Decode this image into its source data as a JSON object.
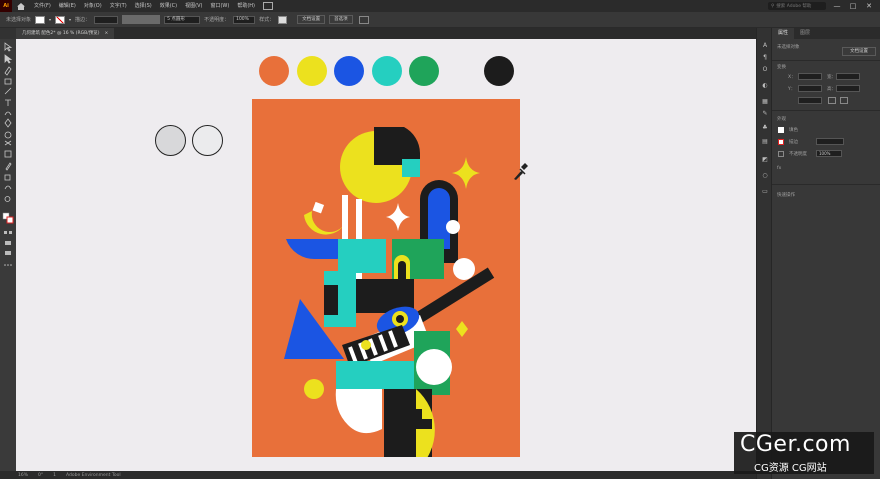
{
  "menubar": {
    "logo": "Ai",
    "items": [
      "文件(F)",
      "编辑(E)",
      "对象(O)",
      "文字(T)",
      "选择(S)",
      "效果(C)",
      "视图(V)",
      "窗口(W)",
      "帮助(H)"
    ],
    "search_placeholder": "搜索 Adobe 帮助",
    "window_controls": [
      "—",
      "□",
      "✕"
    ]
  },
  "controlbar": {
    "selection_label": "未选择对象",
    "stroke_label": "描边：",
    "brush_label": "5 点圆形",
    "opacity_label": "不透明度：",
    "opacity_value": "100%",
    "style_label": "样式：",
    "doc_setup_button": "文档设置",
    "preferences_button": "首选项"
  },
  "document": {
    "tab_title": "几何建筑 配色2* @ 16 % (RGB/预览)",
    "close_label": "×"
  },
  "status": {
    "zoom": "16%",
    "angle": "0°",
    "page": "1",
    "tool_hint": "Adobe Environment Tool"
  },
  "palette": {
    "swatches": [
      {
        "name": "orange",
        "color": "#e8703a"
      },
      {
        "name": "yellow",
        "color": "#ece11e"
      },
      {
        "name": "blue",
        "color": "#1b55e3"
      },
      {
        "name": "teal",
        "color": "#25cfc0"
      },
      {
        "name": "green",
        "color": "#1fa45a"
      },
      {
        "name": "black",
        "color": "#1c1c1c"
      }
    ],
    "outline_circles": [
      "#d8d8da",
      "#ebebed"
    ]
  },
  "properties": {
    "tabs": [
      "属性",
      "图层"
    ],
    "no_selection": "未选择对象",
    "doc_button": "文档设置",
    "transform": "变换",
    "appearance": "外观",
    "fill_label": "填色",
    "stroke_label": "描边",
    "opacity_label": "不透明度",
    "opacity_value": "100%",
    "quick_actions": "快速操作",
    "x_label": "X：",
    "y_label": "Y：",
    "w_label": "宽：",
    "h_label": "高："
  },
  "watermark": {
    "main": "CGer.com",
    "sub": "CG资源 CG网站"
  }
}
